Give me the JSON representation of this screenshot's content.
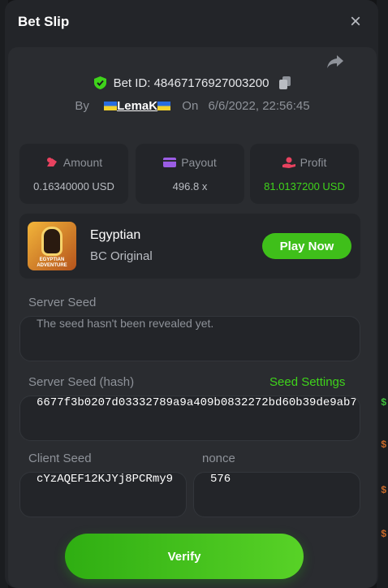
{
  "modal": {
    "title": "Bet Slip",
    "close_icon": "close-icon",
    "share_icon": "share-icon"
  },
  "bet": {
    "id_label": "Bet ID:",
    "id": "48467176927003200",
    "by_label": "By",
    "user": "LemaK",
    "on_label": "On",
    "datetime": "6/6/2022, 22:56:45"
  },
  "stats": {
    "amount": {
      "label": "Amount",
      "value": "0.16340000 USD",
      "icon": "chip-icon"
    },
    "payout": {
      "label": "Payout",
      "value": "496.8 x",
      "icon": "wallet-icon"
    },
    "profit": {
      "label": "Profit",
      "value": "81.0137200 USD",
      "icon": "coins-hand-icon"
    }
  },
  "game": {
    "name": "Egyptian",
    "provider": "BC Original",
    "thumb_text": "EGYPTIAN ADVENTURE",
    "play_label": "Play Now"
  },
  "seeds": {
    "server_seed_label": "Server Seed",
    "server_seed_value": "The seed hasn't been revealed yet.",
    "server_hash_label": "Server Seed (hash)",
    "seed_settings_label": "Seed Settings",
    "server_hash_value": "6677f3b0207d03332789a9a409b0832272bd60b39de9ab7",
    "client_seed_label": "Client Seed",
    "client_seed_value": "cYzAQEF12KJYj8PCRmy9",
    "nonce_label": "nonce",
    "nonce_value": "576"
  },
  "verify_label": "Verify",
  "colors": {
    "accent_green": "#3fbf1a",
    "profit_green": "#3fd31b",
    "modal_bg": "#232529"
  }
}
